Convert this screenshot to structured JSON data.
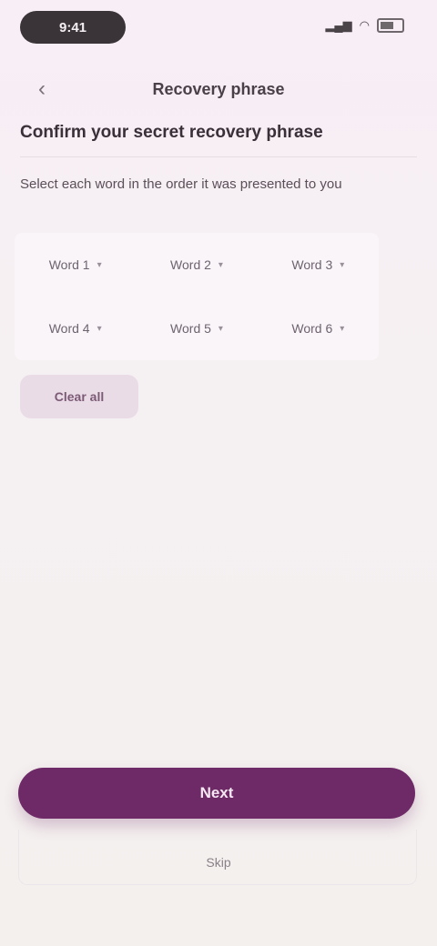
{
  "status_bar": {
    "time": "9:41",
    "signal": "signal-icon",
    "wifi": "wifi-icon",
    "battery": "battery-icon"
  },
  "header": {
    "back_icon": "arrow-left-icon",
    "title": "Recovery phrase"
  },
  "question": "Confirm your secret recovery phrase",
  "instructions": "Select each word in the order it was presented to you",
  "words": [
    {
      "label": "Word 1"
    },
    {
      "label": "Word 2"
    },
    {
      "label": "Word 3"
    },
    {
      "label": "Word 4"
    },
    {
      "label": "Word 5"
    },
    {
      "label": "Word 6"
    }
  ],
  "add_button": "Clear all",
  "cta_label": "Next",
  "secondary_label": "Skip"
}
